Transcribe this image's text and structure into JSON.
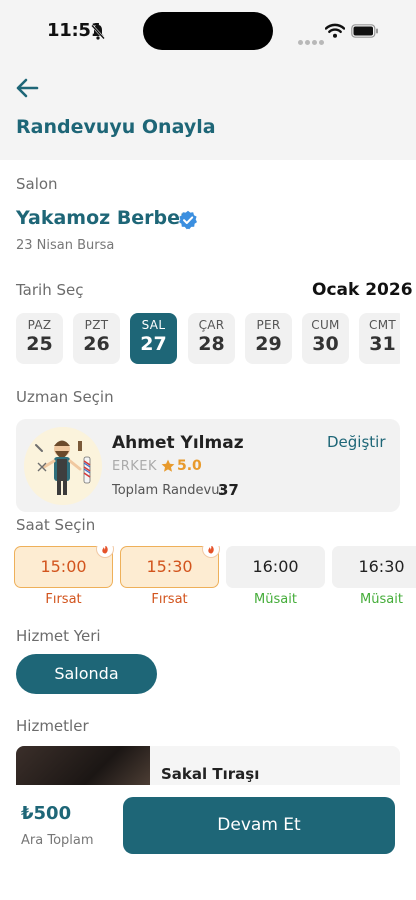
{
  "status_bar": {
    "time": "11:51"
  },
  "header": {
    "title": "Randevuyu Onayla"
  },
  "salon": {
    "section_label": "Salon",
    "name": "Yakamoz Berber",
    "location": "23 Nisan Bursa"
  },
  "date_picker": {
    "section_label": "Tarih Seç",
    "month": "Ocak 2026",
    "days": [
      {
        "name": "PAZ",
        "day": "25",
        "selected": false
      },
      {
        "name": "PZT",
        "day": "26",
        "selected": false
      },
      {
        "name": "SAL",
        "day": "27",
        "selected": true
      },
      {
        "name": "ÇAR",
        "day": "28",
        "selected": false
      },
      {
        "name": "PER",
        "day": "29",
        "selected": false
      },
      {
        "name": "CUM",
        "day": "30",
        "selected": false
      },
      {
        "name": "CMT",
        "day": "31",
        "selected": false
      }
    ]
  },
  "expert": {
    "section_label": "Uzman Seçin",
    "name": "Ahmet Yılmaz",
    "gender": "ERKEK",
    "rating": "5.0",
    "change_label": "Değiştir",
    "total_label": "Toplam Randevu:",
    "total_value": "37"
  },
  "time_slots": {
    "section_label": "Saat Seçin",
    "slots": [
      {
        "time": "15:00",
        "tag": "Fırsat",
        "type": "deal"
      },
      {
        "time": "15:30",
        "tag": "Fırsat",
        "type": "deal"
      },
      {
        "time": "16:00",
        "tag": "Müsait",
        "type": "free"
      },
      {
        "time": "16:30",
        "tag": "Müsait",
        "type": "free"
      }
    ]
  },
  "service_place": {
    "section_label": "Hizmet Yeri",
    "selected": "Salonda"
  },
  "services": {
    "section_label": "Hizmetler",
    "items": [
      {
        "name": "Sakal Tıraşı"
      }
    ]
  },
  "footer": {
    "price": "₺500",
    "subtotal_label": "Ara Toplam",
    "continue_label": "Devam Et"
  },
  "colors": {
    "primary": "#1e6677",
    "deal": "#d2541d",
    "available": "#45ad3a",
    "rating": "#e89a2c"
  }
}
